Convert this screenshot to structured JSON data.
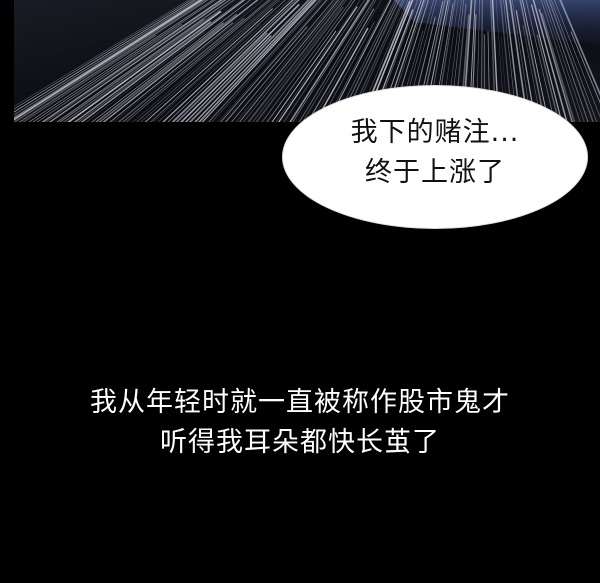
{
  "speech_bubble": {
    "lines": [
      "我下的赌注...",
      "终于上涨了"
    ]
  },
  "narration": {
    "lines": [
      "我从年轻时就一直被称作股市鬼才",
      "听得我耳朵都快长茧了"
    ]
  },
  "colors": {
    "background": "#000000",
    "bubble": "#ffffff",
    "bubble_text": "#111111",
    "narration_text": "#ffffff"
  }
}
